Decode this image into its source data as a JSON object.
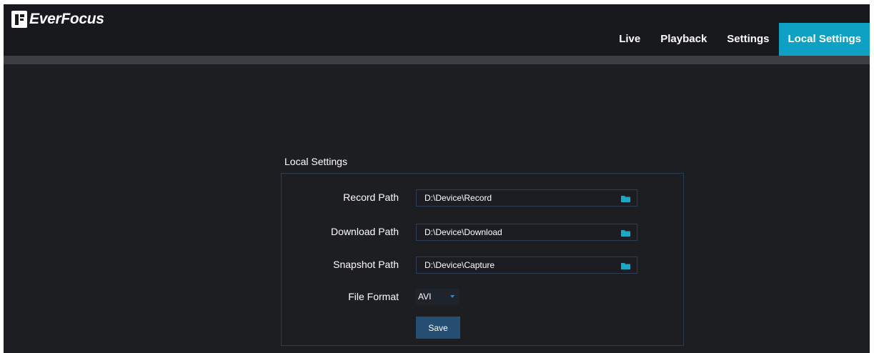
{
  "brand": {
    "name": "EverFocus",
    "logo_icon": "everfocus-logo-icon"
  },
  "nav": {
    "items": [
      {
        "label": "Live",
        "active": false
      },
      {
        "label": "Playback",
        "active": false
      },
      {
        "label": "Settings",
        "active": false
      },
      {
        "label": "Local Settings",
        "active": true
      }
    ]
  },
  "colors": {
    "accent": "#0ea1c4",
    "background": "#1d1e22",
    "topbar": "#18191d",
    "panel_border": "#2c3d55",
    "button": "#264d72",
    "folder_icon": "#1aa8c6"
  },
  "local_settings": {
    "title": "Local Settings",
    "record_path": {
      "label": "Record Path",
      "value": "D:\\Device\\Record",
      "icon": "folder-icon"
    },
    "download_path": {
      "label": "Download Path",
      "value": "D:\\Device\\Download",
      "icon": "folder-icon"
    },
    "snapshot_path": {
      "label": "Snapshot Path",
      "value": "D:\\Device\\Capture",
      "icon": "folder-icon"
    },
    "file_format": {
      "label": "File Format",
      "value": "AVI",
      "icon": "chevron-down-icon"
    },
    "save_label": "Save"
  }
}
